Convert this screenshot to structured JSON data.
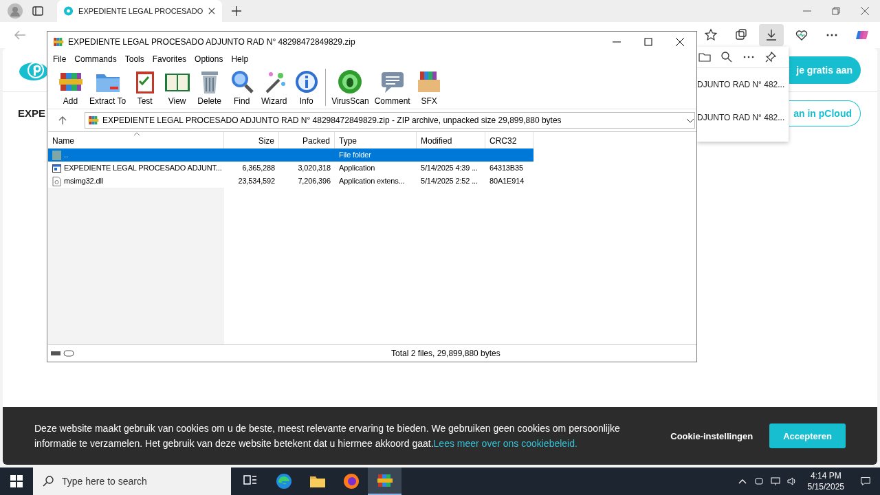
{
  "browser": {
    "tab_title": "EXPEDIENTE LEGAL PROCESADO",
    "toolbar_icons": [
      {
        "kind": "star",
        "selected": false
      },
      {
        "kind": "collections",
        "selected": false
      },
      {
        "kind": "download",
        "selected": true
      },
      {
        "kind": "heart",
        "selected": false
      },
      {
        "kind": "more",
        "selected": false
      },
      {
        "kind": "copilot",
        "selected": false
      }
    ]
  },
  "page": {
    "heading": "EXPE",
    "primary_button": "je gratis aan",
    "secondary_button": "an in pCloud"
  },
  "downloads": {
    "items": [
      {
        "name": "DJUNTO RAD N° 482..."
      },
      {
        "name": "DJUNTO RAD N° 482..."
      }
    ]
  },
  "winrar": {
    "title": "EXPEDIENTE LEGAL PROCESADO ADJUNTO RAD N° 48298472849829.zip",
    "menu": [
      "File",
      "Commands",
      "Tools",
      "Favorites",
      "Options",
      "Help"
    ],
    "toolbar": [
      {
        "kind": "add",
        "label": "Add"
      },
      {
        "kind": "extract",
        "label": "Extract To"
      },
      {
        "kind": "test",
        "label": "Test"
      },
      {
        "kind": "view",
        "label": "View"
      },
      {
        "kind": "delete",
        "label": "Delete"
      },
      {
        "kind": "find",
        "label": "Find"
      },
      {
        "kind": "wizard",
        "label": "Wizard"
      },
      {
        "kind": "info",
        "label": "Info"
      },
      {
        "kind": "virusscan",
        "label": "VirusScan"
      },
      {
        "kind": "comment",
        "label": "Comment"
      },
      {
        "kind": "sfx",
        "label": "SFX"
      }
    ],
    "path": "EXPEDIENTE LEGAL PROCESADO ADJUNTO RAD N° 48298472849829.zip - ZIP archive, unpacked size 29,899,880 bytes",
    "columns": [
      "Name",
      "Size",
      "Packed",
      "Type",
      "Modified",
      "CRC32"
    ],
    "rows": [
      {
        "kind": "folder",
        "selected": true,
        "cells": [
          "..",
          "",
          "",
          "File folder",
          "",
          ""
        ]
      },
      {
        "kind": "app",
        "selected": false,
        "cells": [
          "EXPEDIENTE LEGAL PROCESADO ADJUNT...",
          "6,365,288",
          "3,020,318",
          "Application",
          "5/14/2025 4:39 ...",
          "64313B35"
        ]
      },
      {
        "kind": "dll",
        "selected": false,
        "cells": [
          "msimg32.dll",
          "23,534,592",
          "7,206,396",
          "Application extens...",
          "5/14/2025 2:52 ...",
          "80A1E914"
        ]
      }
    ],
    "status": "Total 2 files, 29,899,880 bytes"
  },
  "cookie": {
    "text": "Deze website maakt gebruik van cookies om u de beste, meest relevante ervaring te bieden. We gebruiken geen cookies om persoonlijke informatie te verzamelen. Het gebruik van deze website betekent dat u hiermee akkoord gaat.",
    "link": "Lees meer over ons cookiebeleid.",
    "settings": "Cookie-instellingen",
    "accept": "Accepteren"
  },
  "taskbar": {
    "search_placeholder": "Type here to search",
    "time": "4:14 PM",
    "date": "5/15/2025",
    "apps": [
      {
        "kind": "taskview",
        "selected": false
      },
      {
        "kind": "edge",
        "selected": false
      },
      {
        "kind": "explorer",
        "selected": false
      },
      {
        "kind": "firefox",
        "selected": false
      },
      {
        "kind": "winrar",
        "selected": true
      }
    ]
  }
}
